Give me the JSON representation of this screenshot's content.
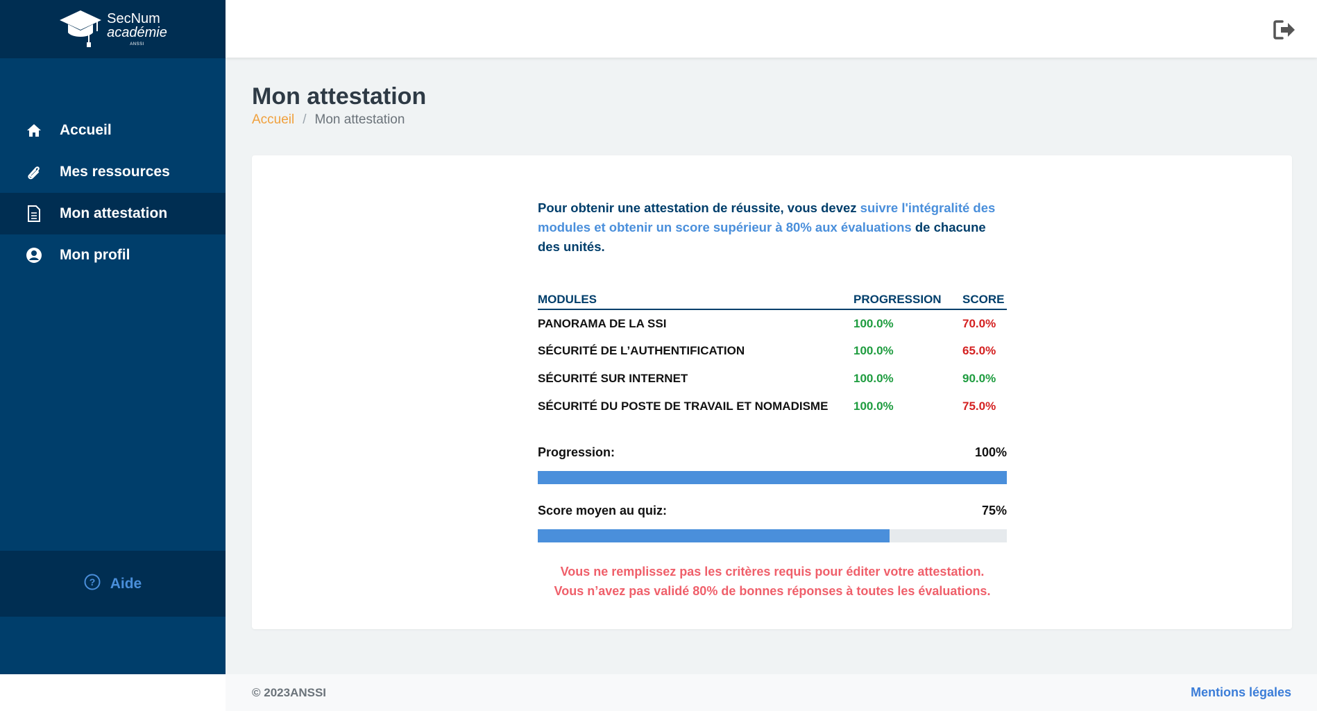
{
  "logo": {
    "line1": "SecNum",
    "line2": "académie",
    "line3": "ANSSI"
  },
  "sidebar": {
    "items": [
      {
        "label": "Accueil",
        "icon": "home-icon"
      },
      {
        "label": "Mes ressources",
        "icon": "paperclip-icon"
      },
      {
        "label": "Mon attestation",
        "icon": "document-icon",
        "active": true
      },
      {
        "label": "Mon profil",
        "icon": "user-circle-icon"
      }
    ],
    "help_label": "Aide"
  },
  "header": {
    "logout_icon": "logout-icon"
  },
  "page": {
    "title": "Mon attestation",
    "breadcrumb": {
      "home": "Accueil",
      "separator": "/",
      "current": "Mon attestation"
    }
  },
  "intro": {
    "part1": "Pour obtenir une attestation de réussite, vous devez ",
    "highlight": "suivre l'intégralité des modules et obtenir un score supérieur à 80% aux évaluations",
    "part2": " de chacune des unités."
  },
  "table": {
    "headers": {
      "module": "MODULES",
      "progression": "PROGRESSION",
      "score": "SCORE"
    },
    "rows": [
      {
        "module": "PANORAMA DE LA SSI",
        "progression": "100.0%",
        "score": "70.0%",
        "status": "fail"
      },
      {
        "module": "SÉCURITÉ DE L’AUTHENTIFICATION",
        "progression": "100.0%",
        "score": "65.0%",
        "status": "fail"
      },
      {
        "module": "SÉCURITÉ SUR INTERNET",
        "progression": "100.0%",
        "score": "90.0%",
        "status": "pass"
      },
      {
        "module": "SÉCURITÉ DU POSTE DE TRAVAIL ET NOMADISME",
        "progression": "100.0%",
        "score": "75.0%",
        "status": "fail"
      }
    ]
  },
  "progress": {
    "label": "Progression:",
    "value_text": "100%",
    "value": 100
  },
  "quiz": {
    "label": "Score moyen au quiz:",
    "value_text": "75%",
    "value": 75
  },
  "warning": {
    "line1": "Vous ne remplissez pas les critères requis pour éditer votre attestation.",
    "line2": "Vous n’avez pas validé 80% de bonnes réponses à toutes les évaluations."
  },
  "footer": {
    "copyright": "© 2023ANSSI",
    "legal": "Mentions légales"
  },
  "colors": {
    "sidebar": "#003e6b",
    "sidebar_dark": "#002e52",
    "accent_blue": "#4a8fdb",
    "breadcrumb_orange": "#f0a03c",
    "success": "#1e9c3f",
    "danger": "#d42121",
    "warning_text": "#ef5f6a"
  }
}
